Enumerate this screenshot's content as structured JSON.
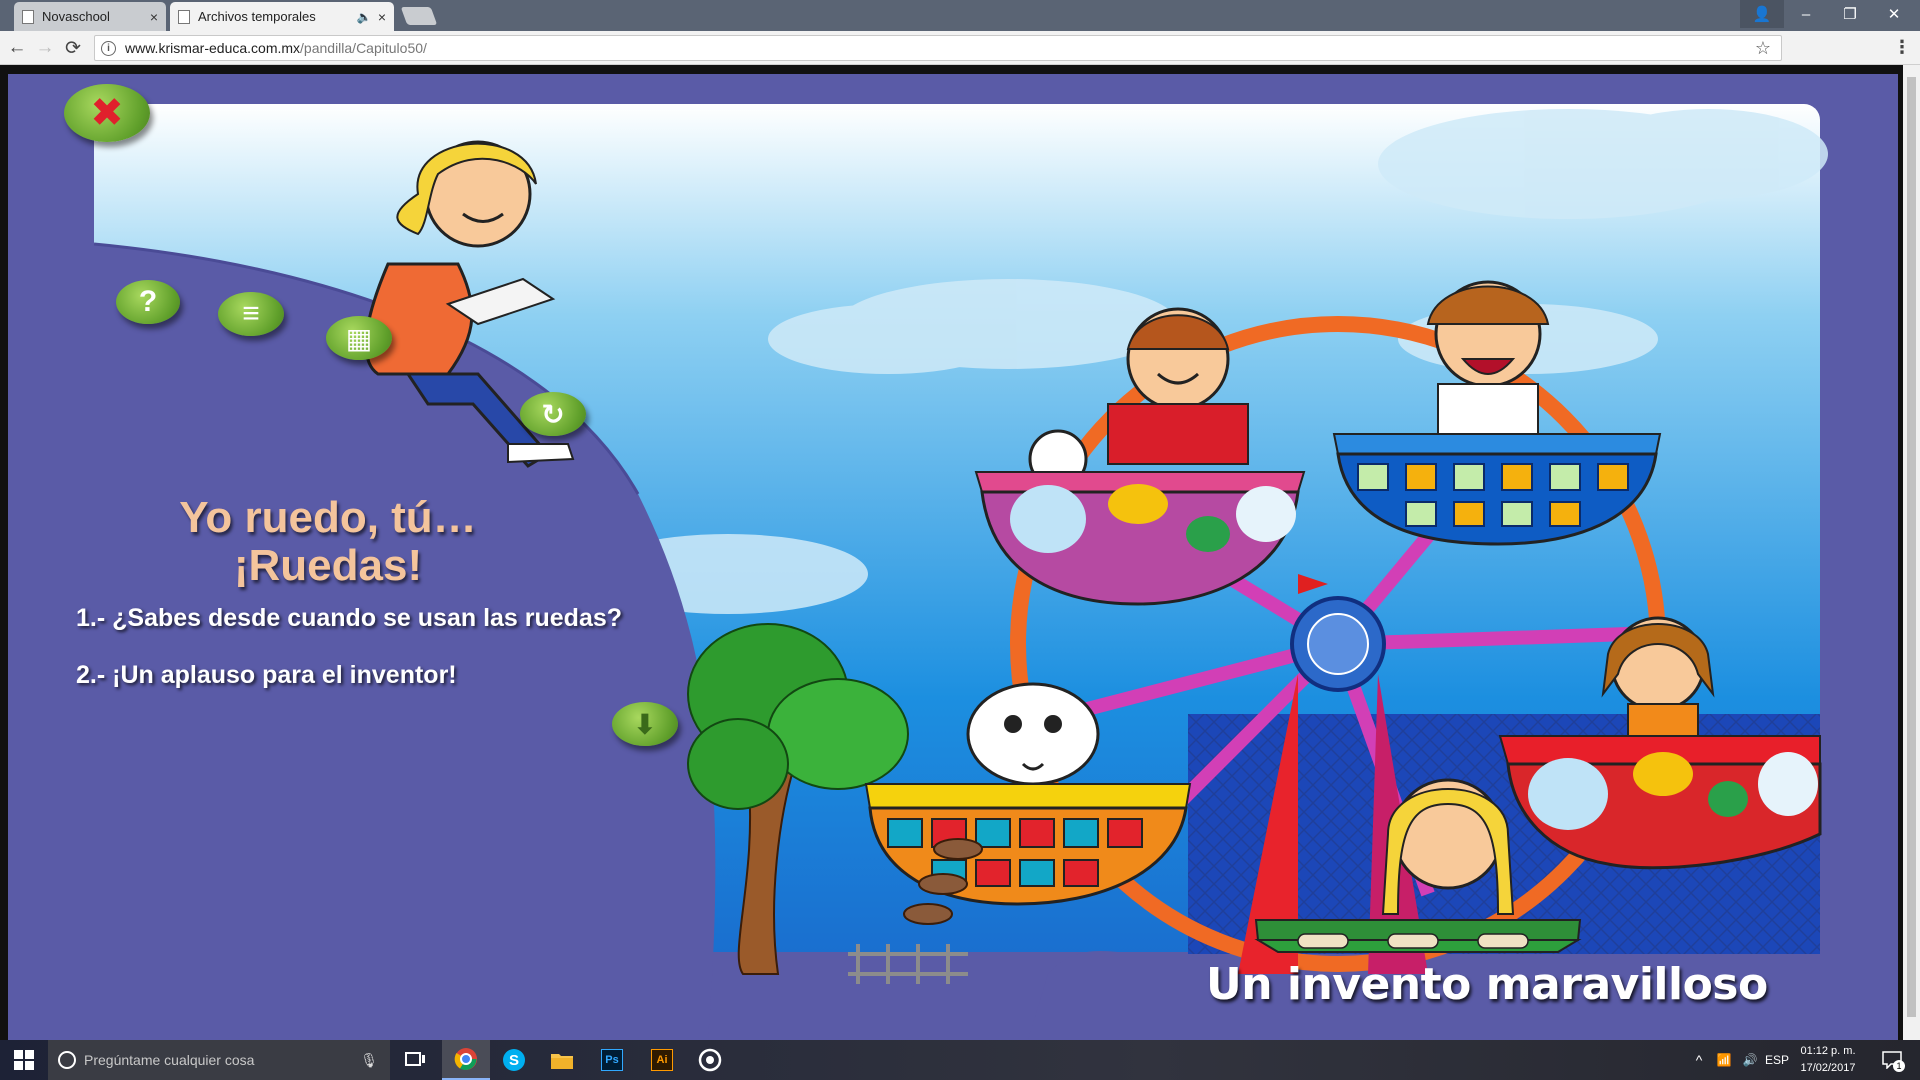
{
  "browser": {
    "tabs": [
      {
        "label": "Novaschool",
        "close": "×"
      },
      {
        "label": "Archivos temporales",
        "close": "×",
        "audio": "🔈"
      }
    ],
    "url_host": "www.krismar-educa.com.mx",
    "url_path": "/pandilla/Capitulo50/",
    "info_glyph": "i",
    "star_glyph": "☆",
    "menu_glyph": "⋮",
    "nav": {
      "back": "←",
      "forward": "→",
      "reload": "⟳"
    },
    "window_controls": {
      "user": "👤",
      "minimize": "–",
      "restore": "❐",
      "close": "✕"
    }
  },
  "lesson": {
    "title_line1": "Yo ruedo, tú…",
    "title_line2": "¡Ruedas!",
    "question1": "1.- ¿Sabes desde cuando se usan las ruedas?",
    "question2": "2.- ¡Un aplauso para el inventor!",
    "subtitle": "Un invento maravilloso",
    "buttons": {
      "help": "?",
      "close": "✖",
      "menu": "≡",
      "puzzle": "▦",
      "replay": "↻",
      "down": "⬇"
    }
  },
  "colors": {
    "background": "#5a5ba7",
    "button_green": "#7fbf3f",
    "title": "#f4c49c",
    "close_x": "#e0202c"
  },
  "taskbar": {
    "search_placeholder": "Pregúntame cualquier cosa",
    "apps": [
      "chrome-icon",
      "skype-icon",
      "file-explorer-icon",
      "photoshop-icon",
      "illustrator-icon",
      "target-app-icon"
    ],
    "ps_label": "Ps",
    "ai_label": "Ai",
    "skype_label": "S",
    "language": "ESP",
    "time": "01:12 p. m.",
    "date": "17/02/2017",
    "notif_count": "1",
    "tray_chevron": "^",
    "wifi": "📶",
    "volume": "🔊"
  }
}
